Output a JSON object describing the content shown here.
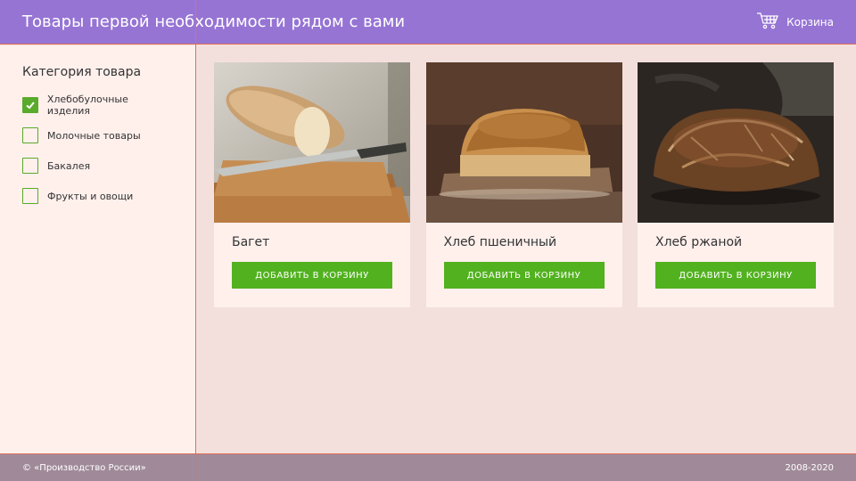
{
  "header": {
    "title": "Товары первой необходимости рядом с вами",
    "cart_label": "Корзина"
  },
  "sidebar": {
    "title": "Категория товара",
    "categories": [
      {
        "label": "Хлебобулочные изделия",
        "checked": true
      },
      {
        "label": "Молочные товары",
        "checked": false
      },
      {
        "label": "Бакалея",
        "checked": false
      },
      {
        "label": "Фрукты и овощи",
        "checked": false
      }
    ]
  },
  "products": [
    {
      "name": "Багет",
      "button": "ДОБАВИТЬ В КОРЗИНУ",
      "image": "baguette-photo"
    },
    {
      "name": "Хлеб пшеничный",
      "button": "ДОБАВИТЬ В КОРЗИНУ",
      "image": "wheat-bread-photo"
    },
    {
      "name": "Хлеб ржаной",
      "button": "ДОБАВИТЬ В КОРЗИНУ",
      "image": "rye-bread-photo"
    }
  ],
  "footer": {
    "left": "© «Производство России»",
    "right": "2008-2020"
  },
  "colors": {
    "header": "#9674d4",
    "accent": "#52b11f",
    "line": "#e0705a",
    "footer": "#a08a9a"
  }
}
